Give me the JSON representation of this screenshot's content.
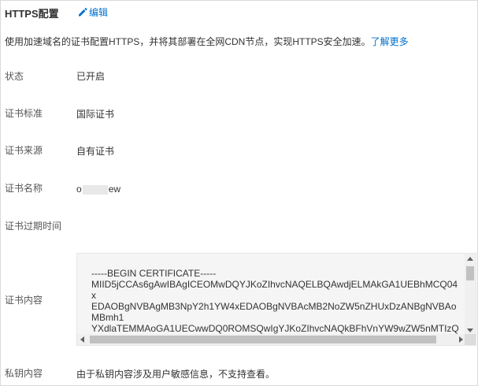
{
  "header": {
    "title": "HTTPS配置",
    "edit_label": "编辑"
  },
  "description": {
    "text": "使用加速域名的证书配置HTTPS，并将其部署在全网CDN节点，实现HTTPS安全加速。",
    "link_label": "了解更多"
  },
  "fields": {
    "status": {
      "label": "状态",
      "value": "已开启"
    },
    "standard": {
      "label": "证书标准",
      "value": "国际证书"
    },
    "source": {
      "label": "证书来源",
      "value": "自有证书"
    },
    "name": {
      "label": "证书名称",
      "value_prefix": "o",
      "value_suffix": "ew"
    },
    "expiry": {
      "label": "证书过期时间",
      "value": ""
    },
    "content": {
      "label": "证书内容",
      "text": "-----BEGIN CERTIFICATE-----\nMIID5jCCAs6gAwIBAgICEOMwDQYJKoZIhvcNAQELBQAwdjELMAkGA1UEBhMCQ04\nx\nEDAOBgNVBAgMB3NpY2h1YW4xEDAOBgNVBAcMB2NoZW5nZHUxDzANBgNVBAo\nMBmh1\nYXdlaTEMMAoGA1UECwwDQ0ROMSQwIgYJKoZIhvcNAQkBFhVnYW9wZW5nMTIzQ"
    },
    "private_key": {
      "label": "私钥内容",
      "value": "由于私钥内容涉及用户敏感信息，不支持查看。"
    }
  },
  "colors": {
    "link": "#0070cc",
    "text": "#333333",
    "label": "#555555",
    "border": "#d9d9d9",
    "code_bg": "#f5f5f5"
  }
}
